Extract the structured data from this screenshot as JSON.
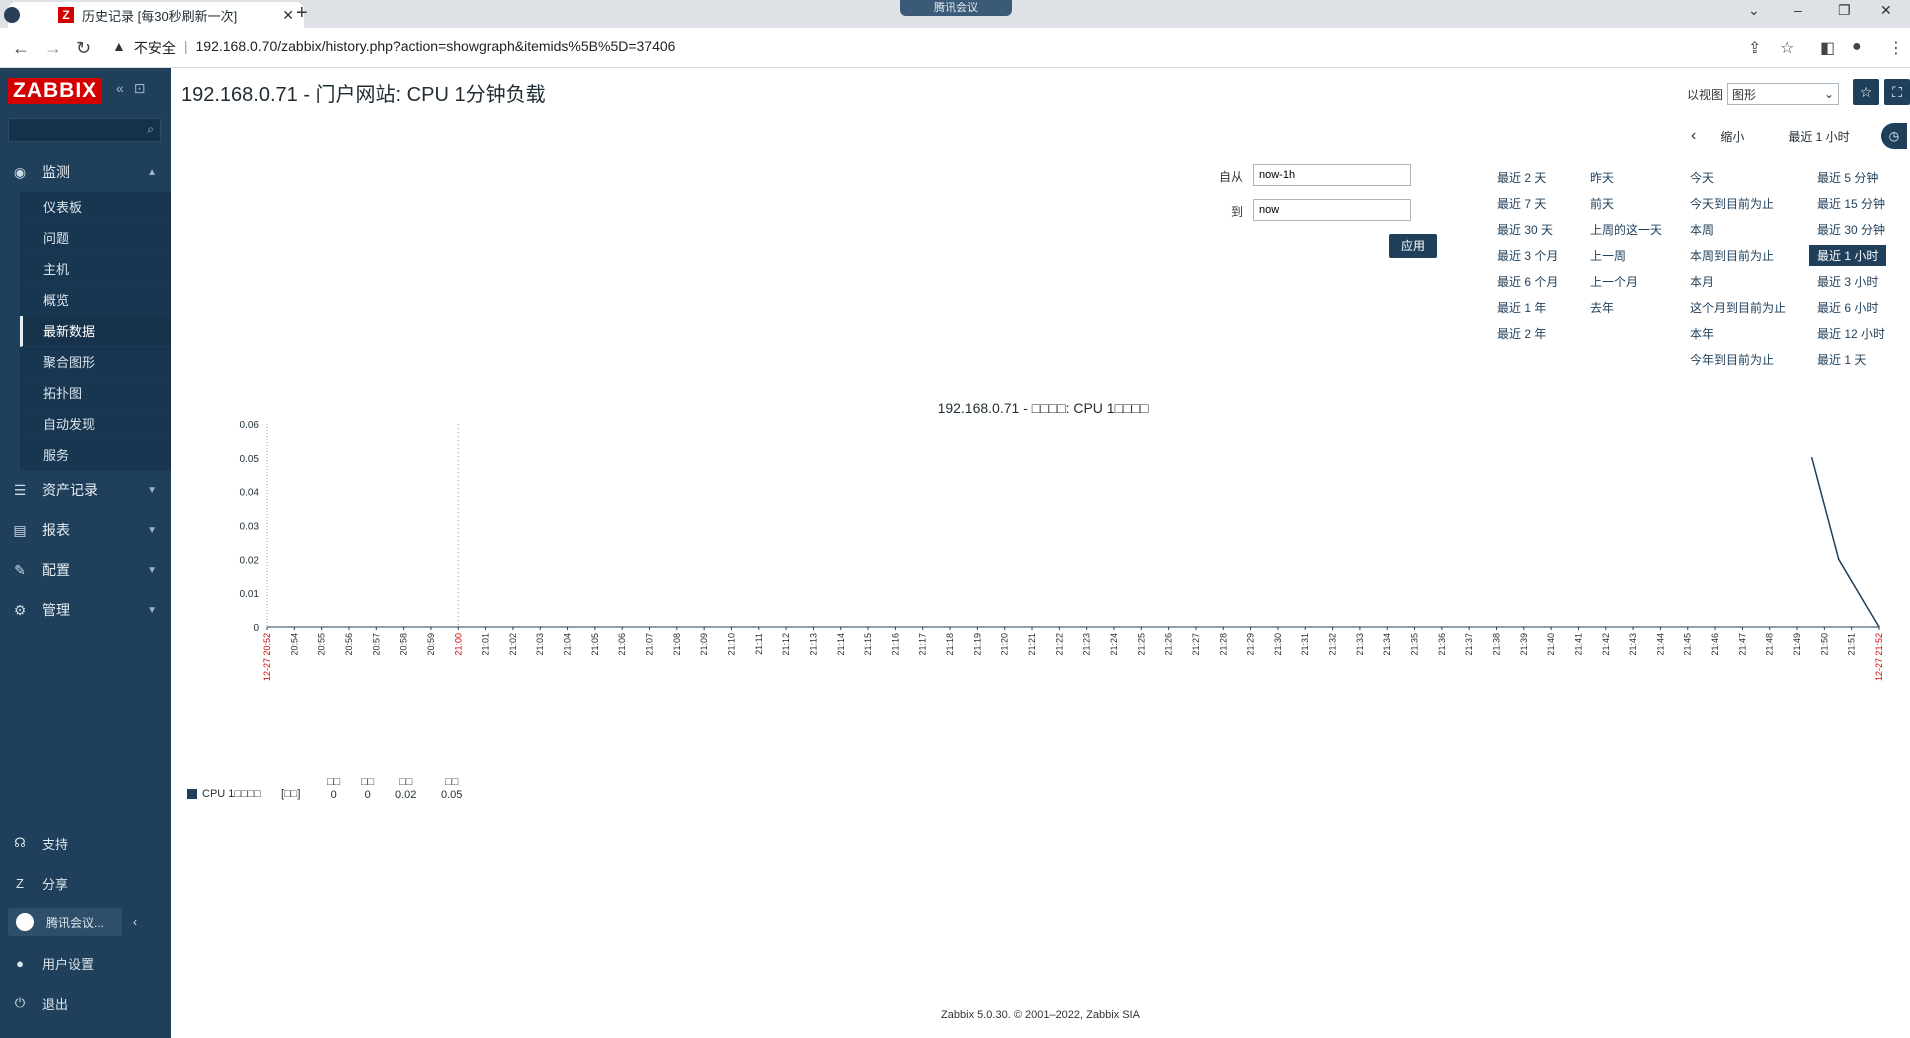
{
  "browser": {
    "tab_title": "历史记录 [每30秒刷新一次]",
    "url_warning": "不安全",
    "url": "192.168.0.70/zabbix/history.php?action=showgraph&itemids%5B%5D=37406",
    "meeting_label": "腾讯会议"
  },
  "sidebar": {
    "logo": "ZABBIX",
    "sections": [
      {
        "label": "监测",
        "icon": "eye-icon"
      },
      {
        "label": "资产记录",
        "icon": "list-icon"
      },
      {
        "label": "报表",
        "icon": "report-icon"
      },
      {
        "label": "配置",
        "icon": "wrench-icon"
      },
      {
        "label": "管理",
        "icon": "gear-icon"
      }
    ],
    "monitor_items": [
      "仪表板",
      "问题",
      "主机",
      "概览",
      "最新数据",
      "聚合图形",
      "拓扑图",
      "自动发现",
      "服务"
    ],
    "active_item": "最新数据",
    "bottom": {
      "support": "支持",
      "share": "分享",
      "user_box": "腾讯会议...",
      "user_settings": "用户设置",
      "logout": "退出"
    }
  },
  "main": {
    "page_title": "192.168.0.71 - 门户网站: CPU 1分钟负载",
    "view_as_label": "以视图",
    "view_as_value": "图形",
    "zoom_out": "缩小",
    "current_range": "最近 1 小时",
    "from_label": "自从",
    "from_value": "now-1h",
    "to_label": "到",
    "to_value": "now",
    "apply_label": "应用",
    "quick_ranges": {
      "col1": [
        "最近 2 天",
        "最近 7 天",
        "最近 30 天",
        "最近 3 个月",
        "最近 6 个月",
        "最近 1 年",
        "最近 2 年"
      ],
      "col2": [
        "昨天",
        "前天",
        "上周的这一天",
        "上一周",
        "上一个月",
        "去年"
      ],
      "col3": [
        "今天",
        "今天到目前为止",
        "本周",
        "本周到目前为止",
        "本月",
        "这个月到目前为止",
        "本年",
        "今年到目前为止"
      ],
      "col4": [
        "最近 5 分钟",
        "最近 15 分钟",
        "最近 30 分钟",
        "最近 1 小时",
        "最近 3 小时",
        "最近 6 小时",
        "最近 12 小时",
        "最近 1 天"
      ],
      "selected": "最近 1 小时"
    },
    "footer": "Zabbix 5.0.30. © 2001–2022, Zabbix SIA"
  },
  "chart_data": {
    "type": "line",
    "title": "192.168.0.71 - □□□□: CPU 1□□□□",
    "ylim": [
      0,
      0.06
    ],
    "y_ticks": [
      "0",
      "0.01",
      "0.02",
      "0.03",
      "0.04",
      "0.05",
      "0.06"
    ],
    "x_ticks": [
      "12-27 20:52",
      "20:54",
      "20:55",
      "20:56",
      "20:57",
      "20:58",
      "20:59",
      "21:00",
      "21:01",
      "21:02",
      "21:03",
      "21:04",
      "21:05",
      "21:06",
      "21:07",
      "21:08",
      "21:09",
      "21:10",
      "21:11",
      "21:12",
      "21:13",
      "21:14",
      "21:15",
      "21:16",
      "21:17",
      "21:18",
      "21:19",
      "21:20",
      "21:21",
      "21:22",
      "21:23",
      "21:24",
      "21:25",
      "21:26",
      "21:27",
      "21:28",
      "21:29",
      "21:30",
      "21:31",
      "21:32",
      "21:33",
      "21:34",
      "21:35",
      "21:36",
      "21:37",
      "21:38",
      "21:39",
      "21:40",
      "21:41",
      "21:42",
      "21:43",
      "21:44",
      "21:45",
      "21:46",
      "21:47",
      "21:48",
      "21:49",
      "21:50",
      "21:51",
      "12-27 21:52"
    ],
    "red_ticks": [
      "12-27 20:52",
      "21:00",
      "12-27 21:52"
    ],
    "series": [
      {
        "name": "CPU 1□□□□",
        "color": "#1f3f5a",
        "x": [
          "21:49.5",
          "21:50.5",
          "21:52"
        ],
        "values": [
          0.05,
          0.02,
          0
        ]
      }
    ],
    "legend": {
      "name": "CPU 1□□□□",
      "func": "[□□]",
      "headers": [
        "□□",
        "□□",
        "□□",
        "□□"
      ],
      "values": [
        "0",
        "0",
        "0.02",
        "0.05"
      ]
    }
  }
}
